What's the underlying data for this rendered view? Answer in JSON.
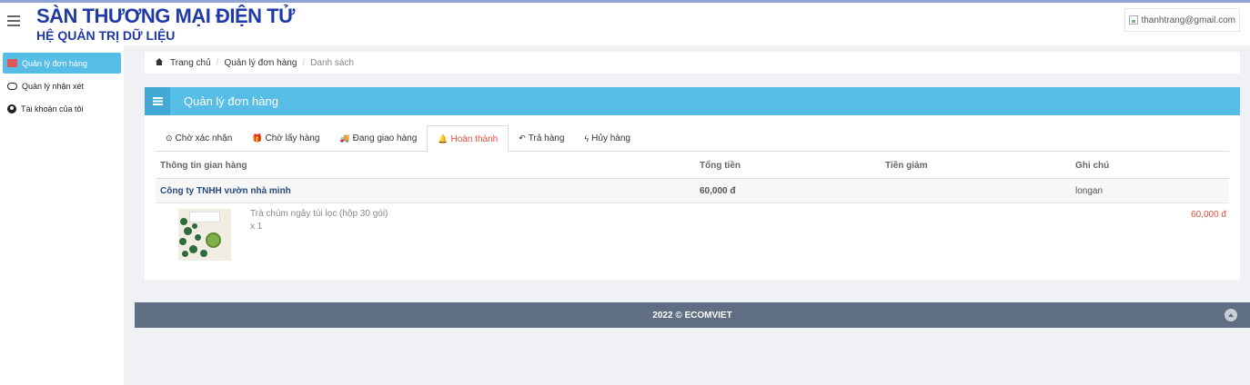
{
  "header": {
    "title": "SÀN THƯƠNG MẠI ĐIỆN TỬ",
    "subtitle": "HỆ QUẢN TRỊ DỮ LIỆU",
    "user_email": "thanhtrang@gmail.com"
  },
  "sidebar": {
    "items": [
      {
        "label": "Quản lý đơn hàng",
        "icon": "flag-icon"
      },
      {
        "label": "Quản lý nhận xét",
        "icon": "comment-icon"
      },
      {
        "label": "Tài khoản của tôi",
        "icon": "user-circle-icon"
      }
    ]
  },
  "breadcrumb": {
    "home": "Trang chủ",
    "section": "Quản lý đơn hàng",
    "current": "Danh sách",
    "separator": "/"
  },
  "panel": {
    "title": "Quản lý đơn hàng"
  },
  "tabs": [
    {
      "label": "Chờ xác nhận",
      "glyph": "⊙"
    },
    {
      "label": "Chờ lấy hàng",
      "glyph": "🎁"
    },
    {
      "label": "Đang giao hàng",
      "glyph": "🚚"
    },
    {
      "label": "Hoàn thành",
      "glyph": "🔔"
    },
    {
      "label": "Trả hàng",
      "glyph": "↶"
    },
    {
      "label": "Hủy hàng",
      "glyph": "ϟ"
    }
  ],
  "table": {
    "headers": [
      "Thông tin gian hàng",
      "Tổng tiền",
      "Tiền giảm",
      "Ghi chú"
    ],
    "shop": {
      "name": "Công ty TNHH vườn nhà minh",
      "total": "60,000 đ",
      "discount": "",
      "note": "longan"
    },
    "product": {
      "name": "Trà chùm ngây túi lọc (hộp 30 gói)",
      "quantity": "x 1",
      "price": "60,000 đ"
    }
  },
  "footer": {
    "text": "2022 © ECOMVIET"
  },
  "colors": {
    "brand": "#1f3aa6",
    "accent": "#55bde6",
    "active_tab": "#e74c3c",
    "footer_bg": "#5f6e83"
  }
}
